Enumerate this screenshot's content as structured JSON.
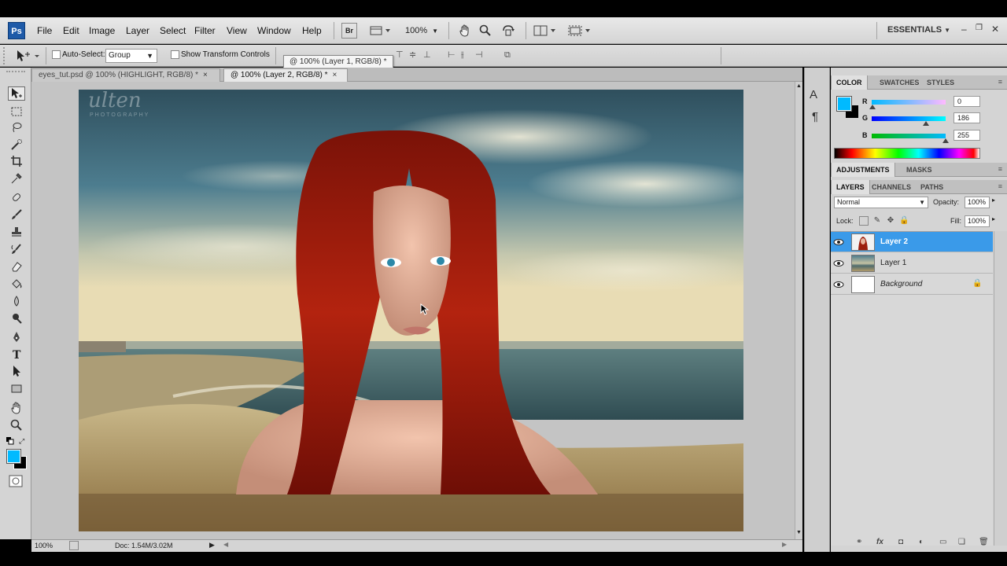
{
  "app": {
    "logo": "Ps",
    "workspace": "ESSENTIALS",
    "zoom_select": "100%"
  },
  "menu": [
    "File",
    "Edit",
    "Image",
    "Layer",
    "Select",
    "Filter",
    "View",
    "Window",
    "Help"
  ],
  "options_bar": {
    "auto_select_label": "Auto-Select:",
    "auto_select_value": "Group",
    "show_transform_label": "Show Transform Controls"
  },
  "tooltip": "@ 100% (Layer 1, RGB/8) *",
  "tabs": [
    {
      "label": "eyes_tut.psd @ 100% (HIGHLIGHT, RGB/8) *",
      "active": false
    },
    {
      "label": "@ 100% (Layer 2, RGB/8) *",
      "active": true
    }
  ],
  "tab_close": "×",
  "canvas": {
    "watermark": "ulten",
    "watermark_sub": "PHOTOGRAPHY"
  },
  "status_bar": {
    "zoom": "100%",
    "doc_info": "Doc: 1.54M/3.02M"
  },
  "color_panel": {
    "tabs": [
      "COLOR",
      "SWATCHES",
      "STYLES"
    ],
    "foreground": "#00baff",
    "background": "#000000",
    "r_label": "R",
    "r_value": "0",
    "g_label": "G",
    "g_value": "186",
    "b_label": "B",
    "b_value": "255"
  },
  "adjust_panel": {
    "tabs": [
      "ADJUSTMENTS",
      "MASKS"
    ]
  },
  "layers_panel": {
    "tabs": [
      "LAYERS",
      "CHANNELS",
      "PATHS"
    ],
    "blend_mode": "Normal",
    "opacity_label": "Opacity:",
    "opacity_value": "100%",
    "lock_label": "Lock:",
    "fill_label": "Fill:",
    "fill_value": "100%",
    "layers": [
      {
        "name": "Layer 2",
        "selected": true
      },
      {
        "name": "Layer 1",
        "selected": false
      },
      {
        "name": "Background",
        "selected": false,
        "locked": true
      }
    ]
  },
  "colors": {
    "selection": "#3a9ae9",
    "accent": "#00baff"
  }
}
